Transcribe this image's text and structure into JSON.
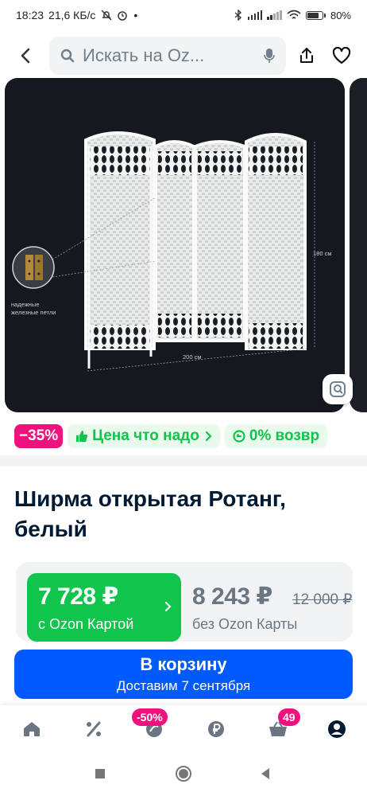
{
  "status_bar": {
    "time": "18:23",
    "speed": "21,6 КБ/с",
    "battery": "80%"
  },
  "search": {
    "placeholder": "Искать на Oz..."
  },
  "image_labels": {
    "hinges": "надежные\nжелезные петли",
    "height": "180 см",
    "width": "200 см"
  },
  "badges": {
    "discount": "−35%",
    "price_label": "Цена что надо",
    "return_label": "0% возвр"
  },
  "product": {
    "title": "Ширма открытая Ротанг, белый"
  },
  "price": {
    "ozon_card_price": "7 728 ₽",
    "ozon_card_caption": "с Ozon Картой",
    "regular_price": "8 243 ₽",
    "old_price": "12 000 ₽",
    "regular_caption": "без Ozon Карты"
  },
  "cart_button": {
    "label": "В корзину",
    "delivery": "Доставим 7 сентября"
  },
  "bottom_nav": {
    "sale_badge": "-50%",
    "cart_count": "49"
  },
  "colors": {
    "accent_blue": "#005bff",
    "green": "#10c44c",
    "pink": "#f1117e"
  }
}
